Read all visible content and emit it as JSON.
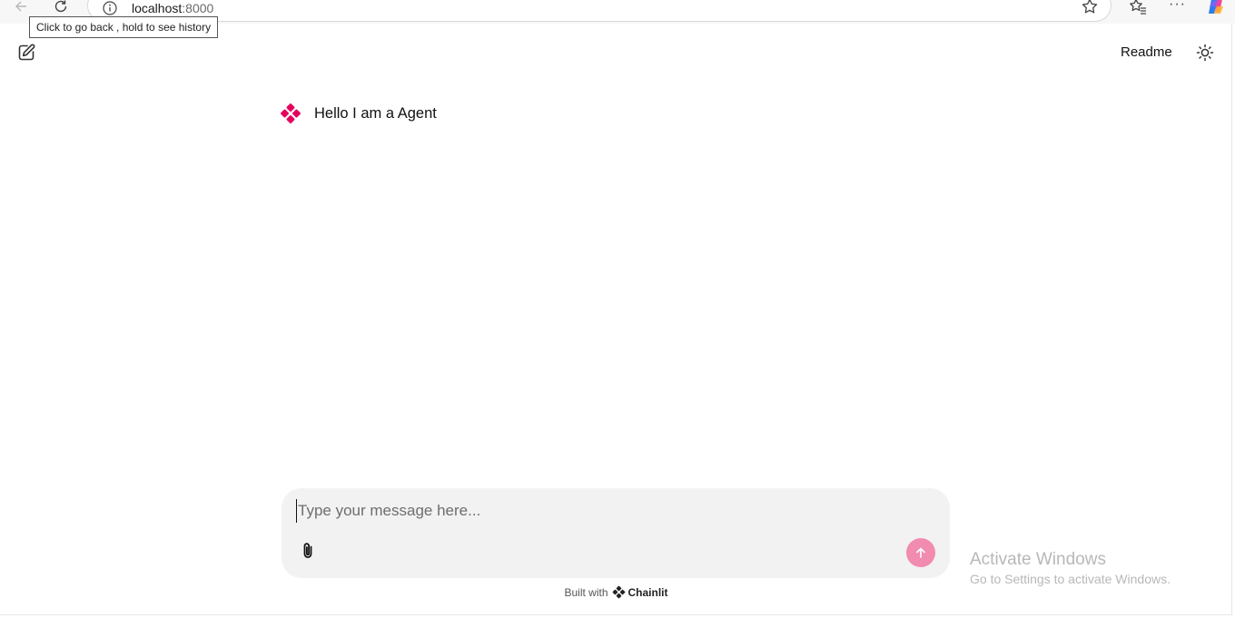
{
  "browser": {
    "url_host": "localhost",
    "url_port": ":8000",
    "tooltip": "Click to go back , hold to see history",
    "more_label": "···"
  },
  "header": {
    "readme_label": "Readme"
  },
  "chat": {
    "messages": [
      {
        "author": "agent",
        "text": "Hello I am a Agent"
      }
    ],
    "input": {
      "placeholder": "Type your message here...",
      "value": ""
    }
  },
  "footer": {
    "prefix": "Built with",
    "brand": "Chainlit"
  },
  "watermark": {
    "title": "Activate Windows",
    "subtitle": "Go to Settings to activate Windows."
  },
  "colors": {
    "accent": "#e5005c",
    "send_button": "#f18bb0",
    "composer_bg": "#f2f2f2"
  },
  "icons": [
    "back-arrow-icon",
    "reload-icon",
    "info-icon",
    "star-icon",
    "favorites-icon",
    "more-icon",
    "copilot-icon",
    "new-chat-icon",
    "sun-icon",
    "agent-logo-icon",
    "paperclip-icon",
    "arrow-up-icon",
    "chainlit-logo-icon"
  ]
}
